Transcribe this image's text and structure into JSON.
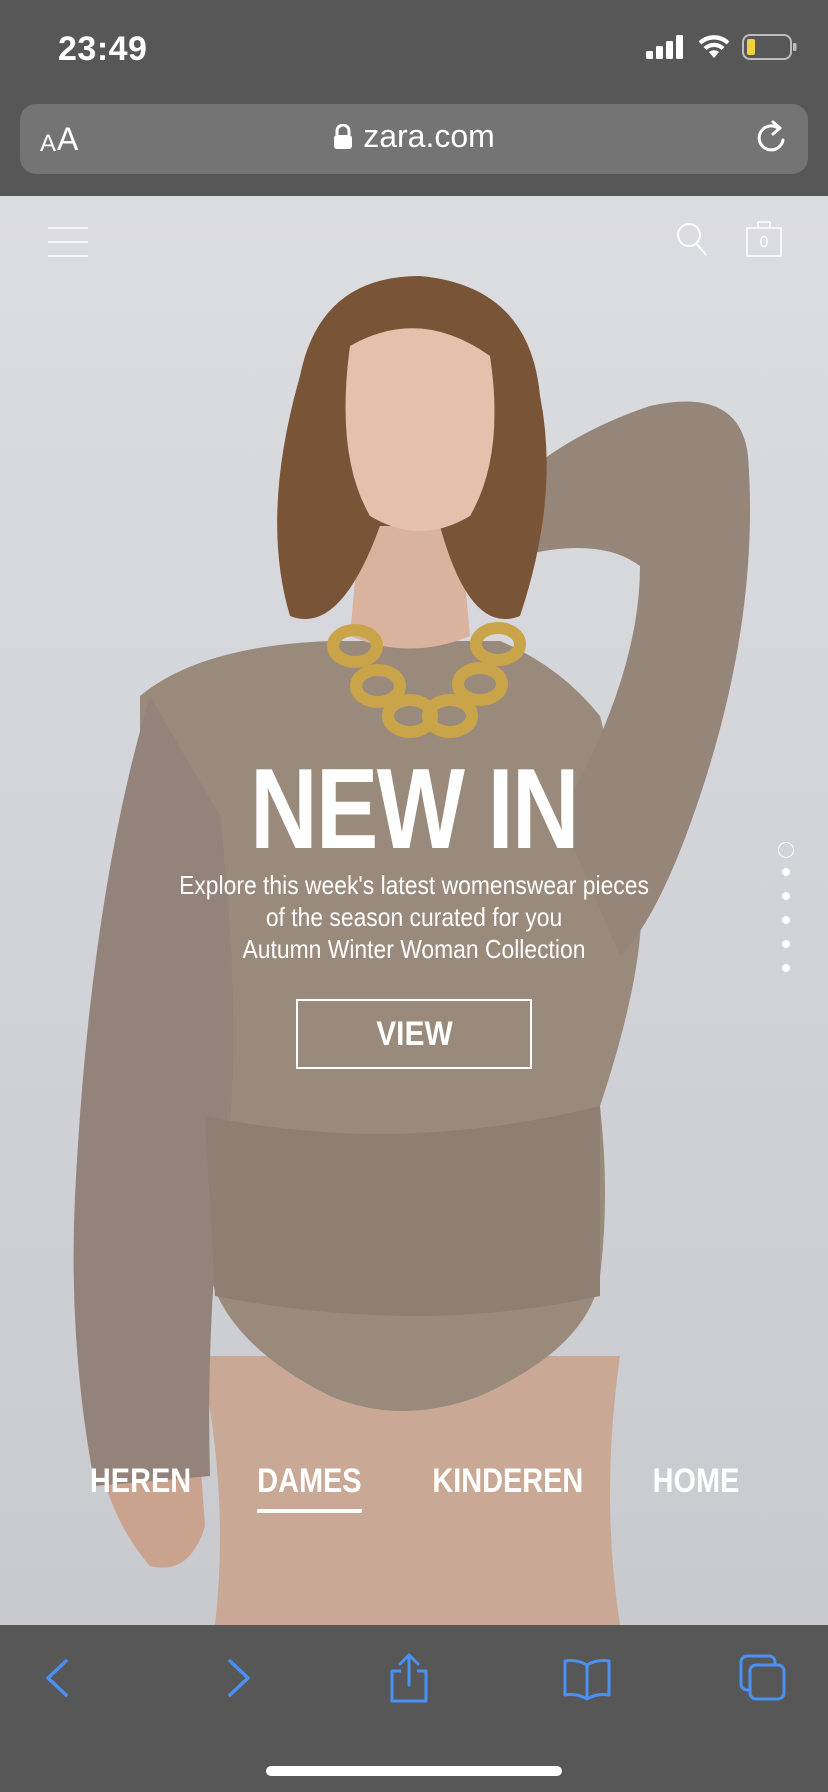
{
  "status_bar": {
    "time": "23:49",
    "icons": [
      "signal-icon",
      "wifi-icon",
      "battery-icon"
    ]
  },
  "browser": {
    "text_size_small": "A",
    "text_size_large": "A",
    "url": "zara.com",
    "icons": [
      "lock-icon",
      "reload-icon"
    ]
  },
  "header": {
    "icons": [
      "menu-icon",
      "search-icon",
      "shopping-bag-icon"
    ],
    "bag_count": "0"
  },
  "hero": {
    "headline": "NEW IN",
    "subtitle_line1": "Explore this week's latest womenswear pieces",
    "subtitle_line2": "of the season curated for you",
    "subtitle_line3": "Autumn Winter Woman Collection",
    "cta_label": "VIEW",
    "slide_count": 6,
    "active_slide": 1
  },
  "nav": {
    "tabs": [
      {
        "label": "HEREN",
        "active": false
      },
      {
        "label": "DAMES",
        "active": true
      },
      {
        "label": "KINDEREN",
        "active": false
      },
      {
        "label": "HOME",
        "active": false
      }
    ]
  },
  "toolbar": {
    "icons": [
      "back-icon",
      "forward-icon",
      "share-icon",
      "bookmarks-icon",
      "tabs-icon"
    ],
    "accent_color": "#4a90f5"
  },
  "colors": {
    "chrome_bg": "#575757",
    "url_bar_bg": "#747474",
    "sweater": "#9a8a7c"
  }
}
